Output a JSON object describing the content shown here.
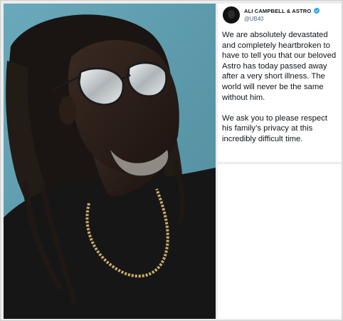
{
  "photo": {
    "alt_subject": "man-with-dreadlocks-and-sunglasses-icon"
  },
  "tweet": {
    "display_name": "ALI CAMPBELL & ASTRO",
    "handle": "@UB40",
    "verified_badge": "verified-icon",
    "paragraphs": [
      "We are absolutely devastated and completely heartbroken to have to tell you that our beloved Astro has today passed away after a very short illness. The world will never be the same without him.",
      "We ask you to please respect his family’s privacy at this incredibly difficult time."
    ]
  },
  "colors": {
    "photo_background": "#5f9fb0",
    "verified_blue": "#1d9bf0",
    "text": "#0f1419",
    "handle_gray": "#536471"
  }
}
